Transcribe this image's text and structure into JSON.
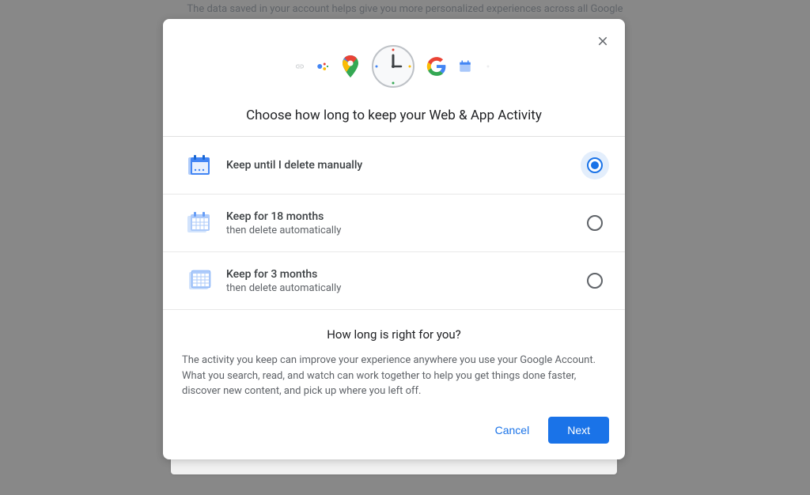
{
  "background": {
    "text": "The data saved in your account helps give you more personalized experiences across all Google"
  },
  "modal": {
    "title": "Choose how long to keep your Web & App Activity",
    "options": [
      {
        "title": "Keep until I delete manually",
        "subtitle": "",
        "selected": true
      },
      {
        "title": "Keep for 18 months",
        "subtitle": "then delete automatically",
        "selected": false
      },
      {
        "title": "Keep for 3 months",
        "subtitle": "then delete automatically",
        "selected": false
      }
    ],
    "info": {
      "heading": "How long is right for you?",
      "body": "The activity you keep can improve your experience anywhere you use your Google Account. What you search, read, and watch can work together to help you get things done faster, discover new content, and pick up where you left off."
    },
    "buttons": {
      "cancel": "Cancel",
      "next": "Next"
    }
  }
}
